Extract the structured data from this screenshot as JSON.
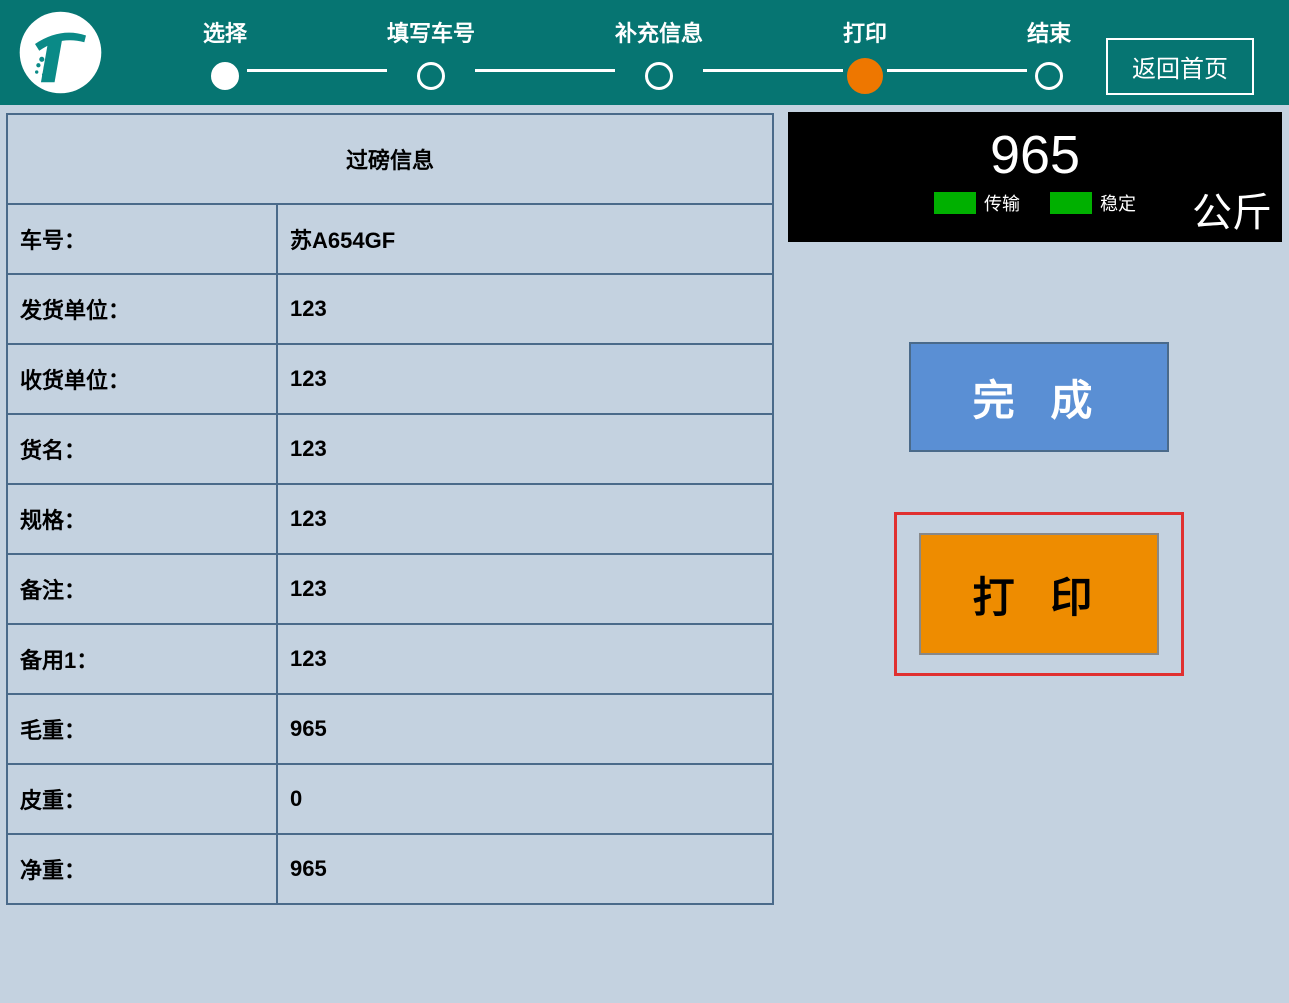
{
  "header": {
    "steps": [
      {
        "label": "选择",
        "state": "filled"
      },
      {
        "label": "填写车号",
        "state": "empty"
      },
      {
        "label": "补充信息",
        "state": "empty"
      },
      {
        "label": "打印",
        "state": "active"
      },
      {
        "label": "结束",
        "state": "empty"
      }
    ],
    "home_button": "返回首页"
  },
  "table": {
    "title": "过磅信息",
    "rows": [
      {
        "label": "车号：",
        "value": "苏A654GF"
      },
      {
        "label": "发货单位：",
        "value": "123"
      },
      {
        "label": "收货单位：",
        "value": "123"
      },
      {
        "label": "货名：",
        "value": "123"
      },
      {
        "label": "规格：",
        "value": "123"
      },
      {
        "label": "备注：",
        "value": "123"
      },
      {
        "label": "备用1：",
        "value": "123"
      },
      {
        "label": "毛重：",
        "value": "965"
      },
      {
        "label": "皮重：",
        "value": "0"
      },
      {
        "label": "净重：",
        "value": "965"
      }
    ]
  },
  "scale": {
    "value": "965",
    "status1": "传输",
    "status2": "稳定",
    "unit": "公斤"
  },
  "buttons": {
    "complete": "完 成",
    "print": "打 印"
  }
}
